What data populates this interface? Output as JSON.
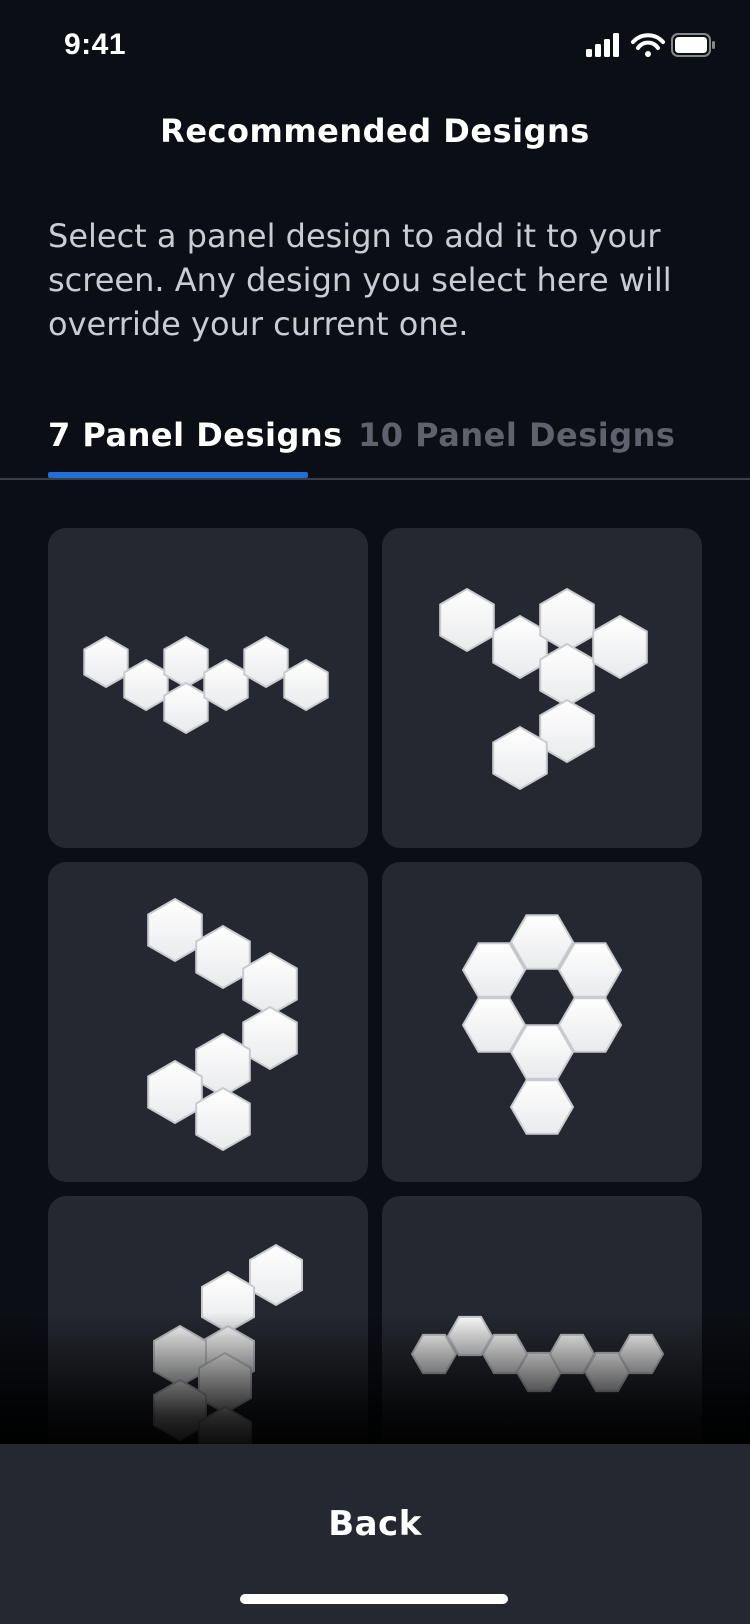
{
  "status_bar": {
    "time": "9:41",
    "icons": [
      "cellular-signal-icon",
      "wifi-icon",
      "battery-icon"
    ]
  },
  "header": {
    "title": "Recommended Designs"
  },
  "description": "Select a panel design to add it to your screen. Any design you select here will override your current one.",
  "tabs": [
    {
      "label": "7 Panel Designs",
      "active": true
    },
    {
      "label": "10 Panel Designs",
      "active": false
    }
  ],
  "colors": {
    "background": "#0b0e14",
    "card": "#252830",
    "accent": "#1f6fd6",
    "inactive_tab": "#5d626c",
    "hexagon": "#ffffff"
  },
  "designs": [
    {
      "name": "design-1",
      "panels": 7
    },
    {
      "name": "design-2",
      "panels": 7
    },
    {
      "name": "design-3",
      "panels": 7
    },
    {
      "name": "design-4",
      "panels": 7
    },
    {
      "name": "design-5",
      "panels": 7
    },
    {
      "name": "design-6",
      "panels": 7
    }
  ],
  "footer": {
    "back_label": "Back"
  }
}
